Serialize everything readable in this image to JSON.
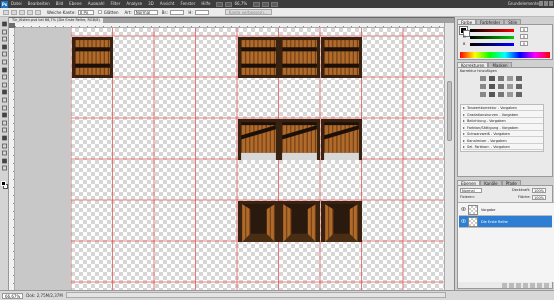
{
  "menubar": {
    "logo": "Ps",
    "items": [
      "Datei",
      "Bearbeiten",
      "Bild",
      "Ebene",
      "Auswahl",
      "Filter",
      "Analyse",
      "3D",
      "Ansicht",
      "Fenster",
      "Hilfe"
    ],
    "zoom": "66,7%",
    "workspace": "Grundelemente"
  },
  "options": {
    "feather_label": "Weiche Kante:",
    "feather_value": "0 Px",
    "antialias_label": "Glätten",
    "style_label": "Art:",
    "style_value": "Normal",
    "width_label": "Br.:",
    "height_label": "H:",
    "refine_label": "Kante verbessern..."
  },
  "document": {
    "tab_label": "Tür_Kisten.psd bei 66,7% (Die Erste Reihe, RGB/8)"
  },
  "status": {
    "zoom": "66,67%",
    "doc_info": "Dok: 2,75M/2,37M"
  },
  "colors": {
    "accent": "#2e7fd3",
    "guide": "#e45a5a",
    "wood_light": "#b06a2a",
    "wood_dark": "#3a2210",
    "panel_bg": "#eaeaea"
  },
  "color_panel": {
    "tabs": [
      "Farbe",
      "Farbfelder",
      "Stile"
    ],
    "r_label": "R",
    "g_label": "G",
    "b_label": "B",
    "r_value": "0",
    "g_value": "0",
    "b_value": "0"
  },
  "adjustments_panel": {
    "tabs": [
      "Korrekturen",
      "Masken"
    ],
    "title": "Korrektur hinzufügen",
    "presets": [
      "Tonwertkorrektur - Vorgaben",
      "Gradationskurven - Vorgaben",
      "Belichtung - Vorgaben",
      "Farbton/Sättigung - Vorgaben",
      "Schwarzweiß - Vorgaben",
      "Kanalmixer - Vorgaben",
      "Sel. Farbkorr. - Vorgaben"
    ]
  },
  "layers_panel": {
    "tabs": [
      "Ebenen",
      "Kanäle",
      "Pfade"
    ],
    "blend_mode": "Normal",
    "opacity_label": "Deckkraft:",
    "opacity_value": "100%",
    "lock_label": "Fixieren:",
    "fill_label": "Fläche:",
    "fill_value": "100%",
    "layers": [
      {
        "name": "Vorgabe",
        "selected": false
      },
      {
        "name": "Die Erste Reihe",
        "selected": true
      }
    ]
  },
  "toolbox": {
    "tools": [
      "move-tool",
      "marquee-tool",
      "lasso-tool",
      "quick-select-tool",
      "crop-tool",
      "eyedropper-tool",
      "healing-tool",
      "brush-tool",
      "clone-stamp-tool",
      "history-brush-tool",
      "eraser-tool",
      "gradient-tool",
      "dodge-tool",
      "pen-tool",
      "type-tool",
      "path-select-tool",
      "shape-tool",
      "3d-rotate-tool",
      "hand-tool",
      "zoom-tool"
    ]
  }
}
